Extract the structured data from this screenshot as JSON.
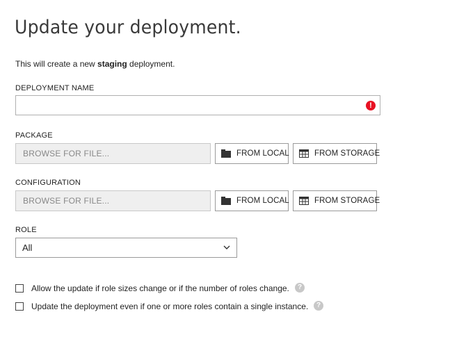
{
  "page": {
    "title": "Update your deployment.",
    "subtitle_prefix": "This will create a new ",
    "subtitle_bold": "staging",
    "subtitle_suffix": " deployment."
  },
  "deployment_name": {
    "label": "DEPLOYMENT NAME",
    "value": "",
    "error_icon": "!"
  },
  "package": {
    "label": "PACKAGE",
    "browse_placeholder": "BROWSE FOR FILE...",
    "from_local_label": "FROM LOCAL",
    "from_storage_label": "FROM STORAGE"
  },
  "configuration": {
    "label": "CONFIGURATION",
    "browse_placeholder": "BROWSE FOR FILE...",
    "from_local_label": "FROM LOCAL",
    "from_storage_label": "FROM STORAGE"
  },
  "role": {
    "label": "ROLE",
    "selected": "All"
  },
  "options": [
    {
      "label": "Allow the update if role sizes change or if the number of roles change.",
      "checked": false,
      "help": "?"
    },
    {
      "label": "Update the deployment even if one or more roles contain a single instance.",
      "checked": false,
      "help": "?"
    }
  ],
  "colors": {
    "error": "#e81123",
    "help_icon": "#c8c8c8",
    "browse_bg": "#efefef"
  },
  "icons": {
    "from_local": "folder-icon",
    "from_storage": "table-storage-icon",
    "select": "chevron-down-icon",
    "error": "error-icon",
    "help": "help-icon"
  }
}
